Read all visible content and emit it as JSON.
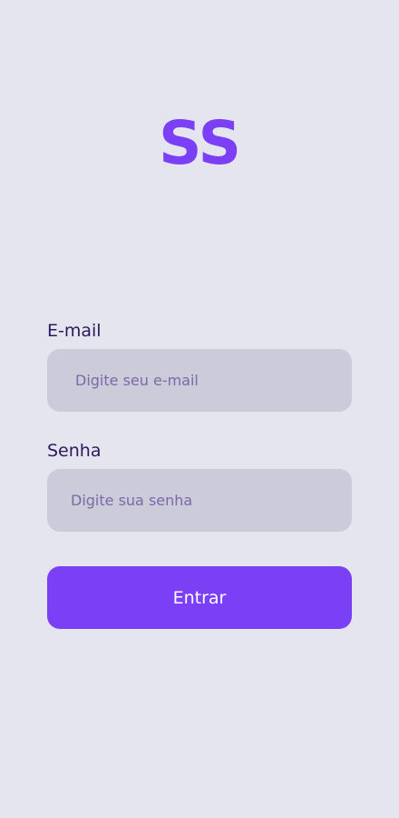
{
  "logo": {
    "text": "SS",
    "color": "#7b3ff5"
  },
  "form": {
    "email": {
      "label": "E-mail",
      "placeholder": "Digite seu e-mail",
      "value": ""
    },
    "password": {
      "label": "Senha",
      "placeholder": "Digite sua senha",
      "value": ""
    },
    "submit_label": "Entrar"
  },
  "colors": {
    "background": "#e5e5f0",
    "accent": "#7b3ff5",
    "input_background": "#cbcbda",
    "label_text": "#2c1a5c"
  }
}
